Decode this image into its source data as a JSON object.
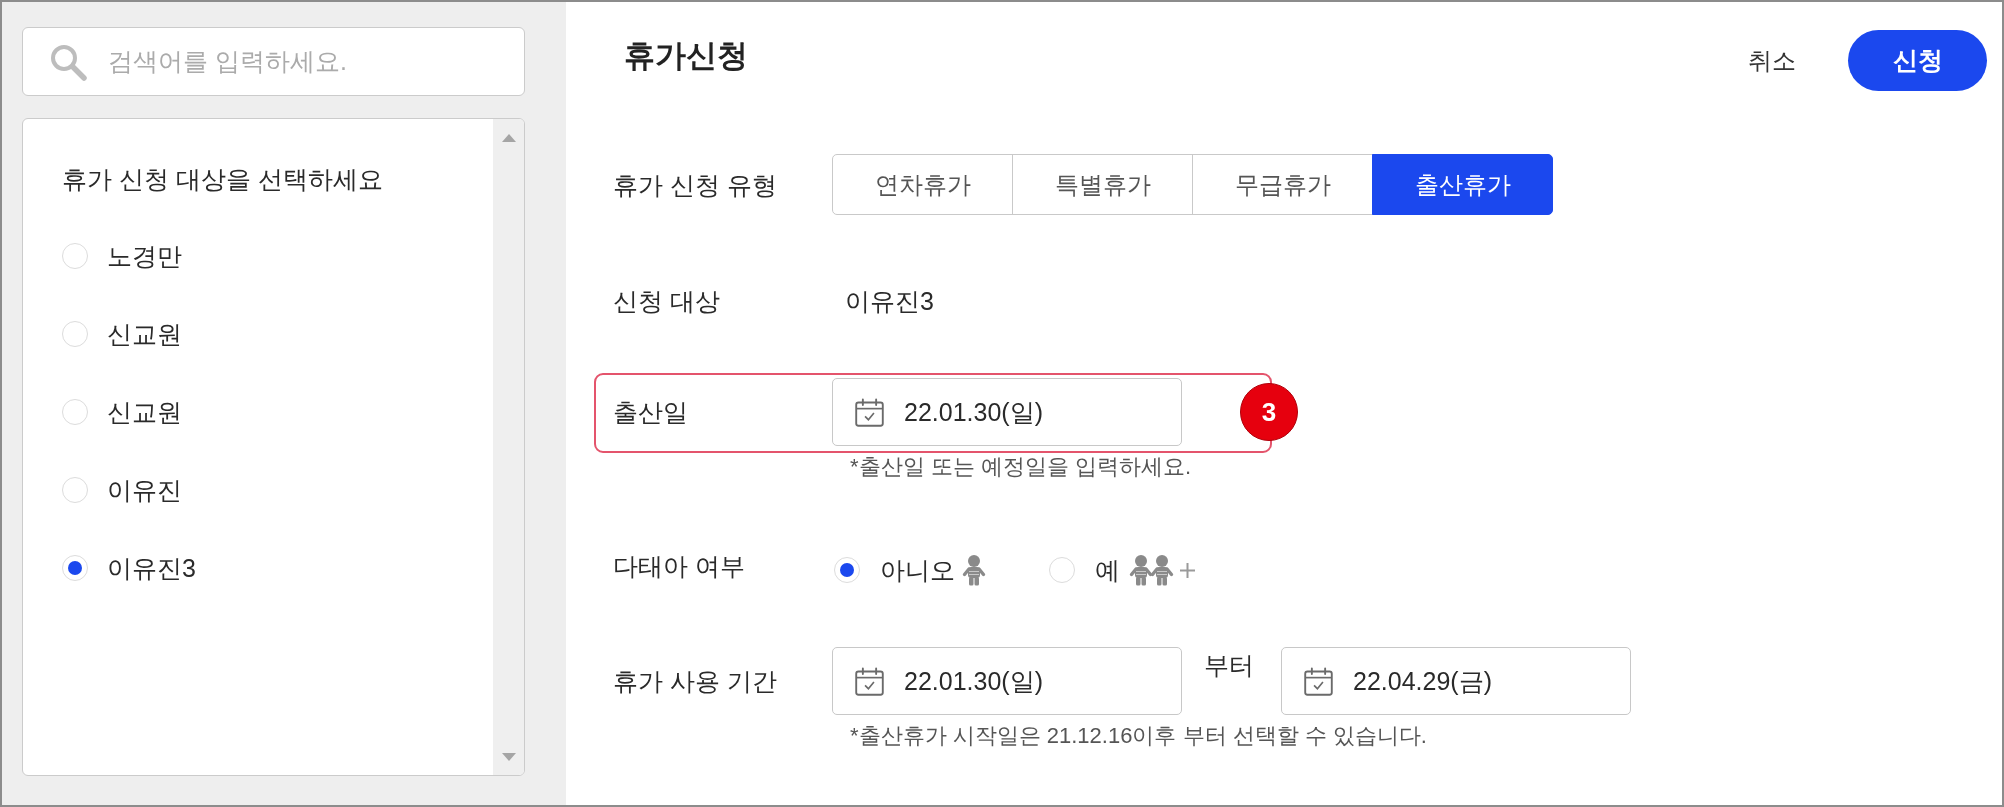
{
  "sidebar": {
    "search": {
      "placeholder": "검색어를 입력하세요."
    },
    "list_title": "휴가 신청 대상을 선택하세요",
    "people": [
      {
        "name": "노경만",
        "selected": false
      },
      {
        "name": "신교원",
        "selected": false
      },
      {
        "name": "신교원",
        "selected": false
      },
      {
        "name": "이유진",
        "selected": false
      },
      {
        "name": "이유진3",
        "selected": true
      }
    ]
  },
  "header": {
    "title": "휴가신청",
    "buttons": [
      {
        "label": "취소",
        "kind": "text"
      },
      {
        "label": "신청",
        "kind": "primary"
      }
    ]
  },
  "form": {
    "rows": [
      {
        "kind": "segmented",
        "label": "휴가 신청 유형",
        "options": [
          {
            "label": "연차휴가",
            "selected": false
          },
          {
            "label": "특별휴가",
            "selected": false
          },
          {
            "label": "무급휴가",
            "selected": false
          },
          {
            "label": "출산휴가",
            "selected": true
          }
        ]
      },
      {
        "kind": "text",
        "label": "신청 대상",
        "value": "이유진3"
      },
      {
        "kind": "date",
        "label": "출산일",
        "callout": "3",
        "dates": [
          "22.01.30(일)"
        ],
        "hint": "*출산일 또는 예정일을 입력하세요."
      },
      {
        "kind": "radio",
        "label": "다태아 여부",
        "options": [
          {
            "label": "아니오",
            "kind": "single",
            "selected": true
          },
          {
            "label": "예",
            "kind": "multiple",
            "selected": false
          }
        ]
      },
      {
        "kind": "date",
        "label": "휴가 사용 기간",
        "dates": [
          "22.01.30(일)",
          "22.04.29(금)"
        ],
        "separator": "부터",
        "hint": "*출산휴가 시작일은 21.12.16이후 부터 선택할 수 있습니다."
      }
    ]
  }
}
